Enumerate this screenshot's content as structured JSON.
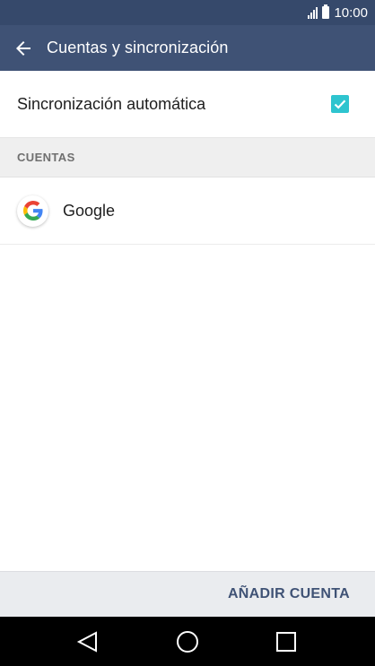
{
  "status_bar": {
    "time": "10:00"
  },
  "app_bar": {
    "title": "Cuentas y sincronización",
    "back_icon": "arrow-left-icon"
  },
  "settings": {
    "auto_sync": {
      "label": "Sincronización automática",
      "checked": true
    }
  },
  "accounts_section": {
    "header": "CUENTAS",
    "items": [
      {
        "name": "Google",
        "icon": "google-icon"
      }
    ]
  },
  "bottom_bar": {
    "add_account_label": "AÑADIR CUENTA"
  },
  "nav_bar": {
    "back_icon": "triangle-back-icon",
    "home_icon": "circle-home-icon",
    "recents_icon": "square-recents-icon"
  },
  "colors": {
    "status_bar": "#36496b",
    "app_bar": "#3f5275",
    "checkbox": "#2ec4cf",
    "section_bg": "#efefef",
    "accent_text": "#3f5275"
  }
}
